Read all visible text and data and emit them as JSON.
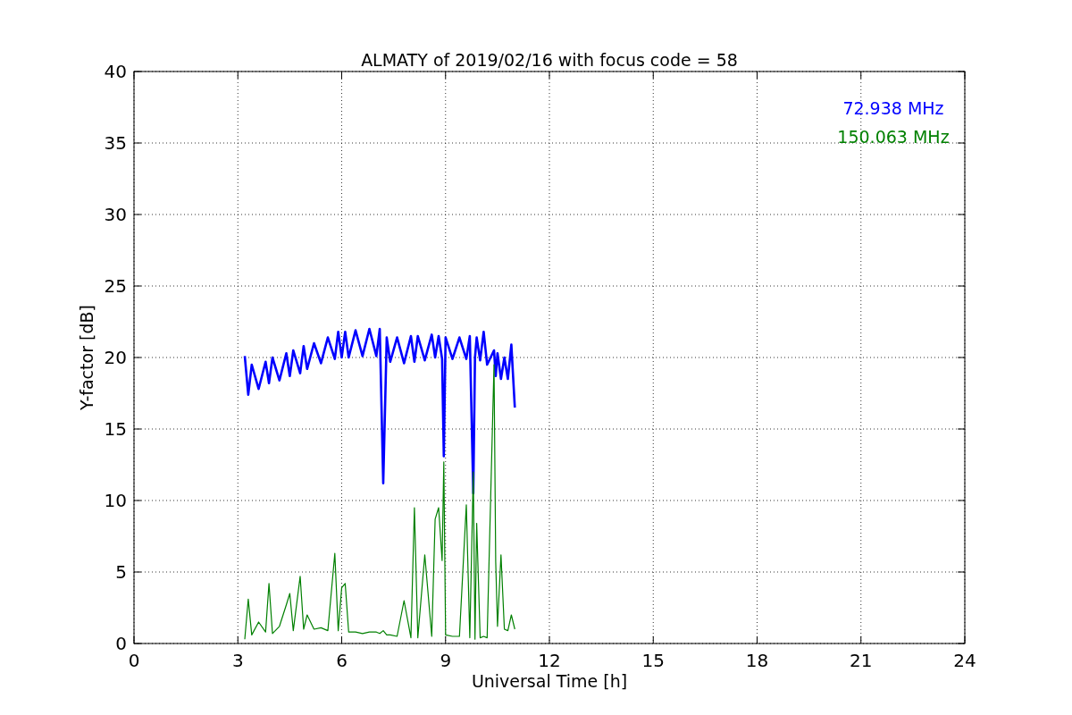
{
  "chart_data": {
    "type": "line",
    "title": "ALMATY of 2019/02/16 with focus code = 58",
    "xlabel": "Universal Time [h]",
    "ylabel": "Y-factor [dB]",
    "xlim": [
      0,
      24
    ],
    "ylim": [
      0,
      40
    ],
    "xticks": [
      0,
      3,
      6,
      9,
      12,
      15,
      18,
      21,
      24
    ],
    "yticks": [
      0,
      5,
      10,
      15,
      20,
      25,
      30,
      35,
      40
    ],
    "grid": true,
    "x": [
      3.2,
      3.3,
      3.4,
      3.6,
      3.8,
      3.9,
      4.0,
      4.2,
      4.4,
      4.5,
      4.6,
      4.8,
      4.9,
      5.0,
      5.2,
      5.4,
      5.6,
      5.8,
      5.9,
      6.0,
      6.1,
      6.2,
      6.4,
      6.6,
      6.8,
      7.0,
      7.1,
      7.2,
      7.3,
      7.4,
      7.6,
      7.8,
      8.0,
      8.1,
      8.2,
      8.4,
      8.6,
      8.7,
      8.8,
      8.9,
      8.95,
      9.0,
      9.2,
      9.4,
      9.6,
      9.7,
      9.8,
      9.85,
      9.9,
      10.0,
      10.1,
      10.2,
      10.4,
      10.45,
      10.5,
      10.6,
      10.7,
      10.8,
      10.9,
      11.0
    ],
    "series": [
      {
        "name": "72.938 MHz",
        "color": "#0000ff",
        "values": [
          20.1,
          17.4,
          19.5,
          17.8,
          19.7,
          18.2,
          20.0,
          18.4,
          20.3,
          18.7,
          20.5,
          18.9,
          20.8,
          19.2,
          21.0,
          19.6,
          21.4,
          19.9,
          21.8,
          20.0,
          21.8,
          20.0,
          21.9,
          20.1,
          22.0,
          20.1,
          22.0,
          11.2,
          21.4,
          19.7,
          21.4,
          19.6,
          21.5,
          19.7,
          21.5,
          19.8,
          21.6,
          20.0,
          21.5,
          19.9,
          13.1,
          21.4,
          19.9,
          21.4,
          19.9,
          21.5,
          10.5,
          20.0,
          21.4,
          19.8,
          21.8,
          19.5,
          20.5,
          18.7,
          20.3,
          18.5,
          20.0,
          18.5,
          20.9,
          16.5
        ]
      },
      {
        "name": "150.063 MHz",
        "color": "#008000",
        "values": [
          0.3,
          3.1,
          0.6,
          1.5,
          0.8,
          4.2,
          0.7,
          1.2,
          2.7,
          3.5,
          0.9,
          4.7,
          1.0,
          2.0,
          1.0,
          1.1,
          0.9,
          6.3,
          0.9,
          3.9,
          4.2,
          0.8,
          0.8,
          0.7,
          0.8,
          0.8,
          0.7,
          0.9,
          0.6,
          0.6,
          0.5,
          3.0,
          0.4,
          9.5,
          0.4,
          6.2,
          0.5,
          8.7,
          9.5,
          5.8,
          12.7,
          0.6,
          0.5,
          0.5,
          9.7,
          0.4,
          12.0,
          0.3,
          8.4,
          0.4,
          0.5,
          0.4,
          19.5,
          5.7,
          1.2,
          6.2,
          1.0,
          0.9,
          2.0,
          1.0
        ]
      }
    ]
  }
}
